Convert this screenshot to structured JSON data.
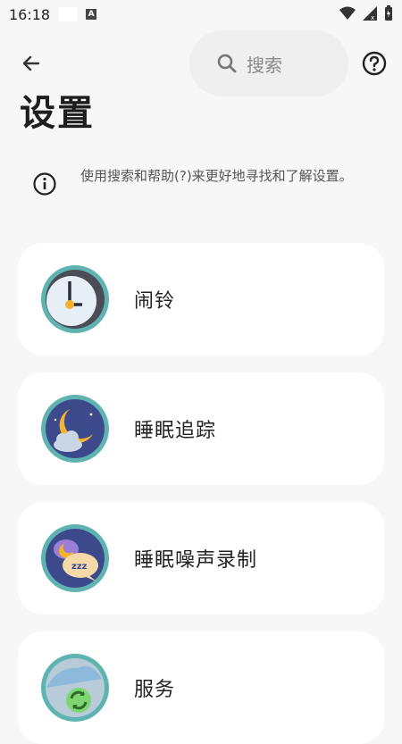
{
  "status": {
    "time": "16:18",
    "a_badge": "A"
  },
  "header": {
    "search_placeholder": "搜索",
    "title": "设置"
  },
  "info": {
    "text": "使用搜索和帮助(?)来更好地寻找和了解设置。"
  },
  "cards": [
    {
      "label": "闹铃",
      "icon": "alarm-clock-icon"
    },
    {
      "label": "睡眠追踪",
      "icon": "moon-cloud-icon"
    },
    {
      "label": "睡眠噪声录制",
      "icon": "sleep-talk-icon"
    },
    {
      "label": "服务",
      "icon": "sync-cloud-icon"
    }
  ],
  "colors": {
    "avatar_ring": "#5fb3b0",
    "avatar_bg": "#3c4a8c",
    "background": "#f7f7f7",
    "card": "#ffffff"
  }
}
